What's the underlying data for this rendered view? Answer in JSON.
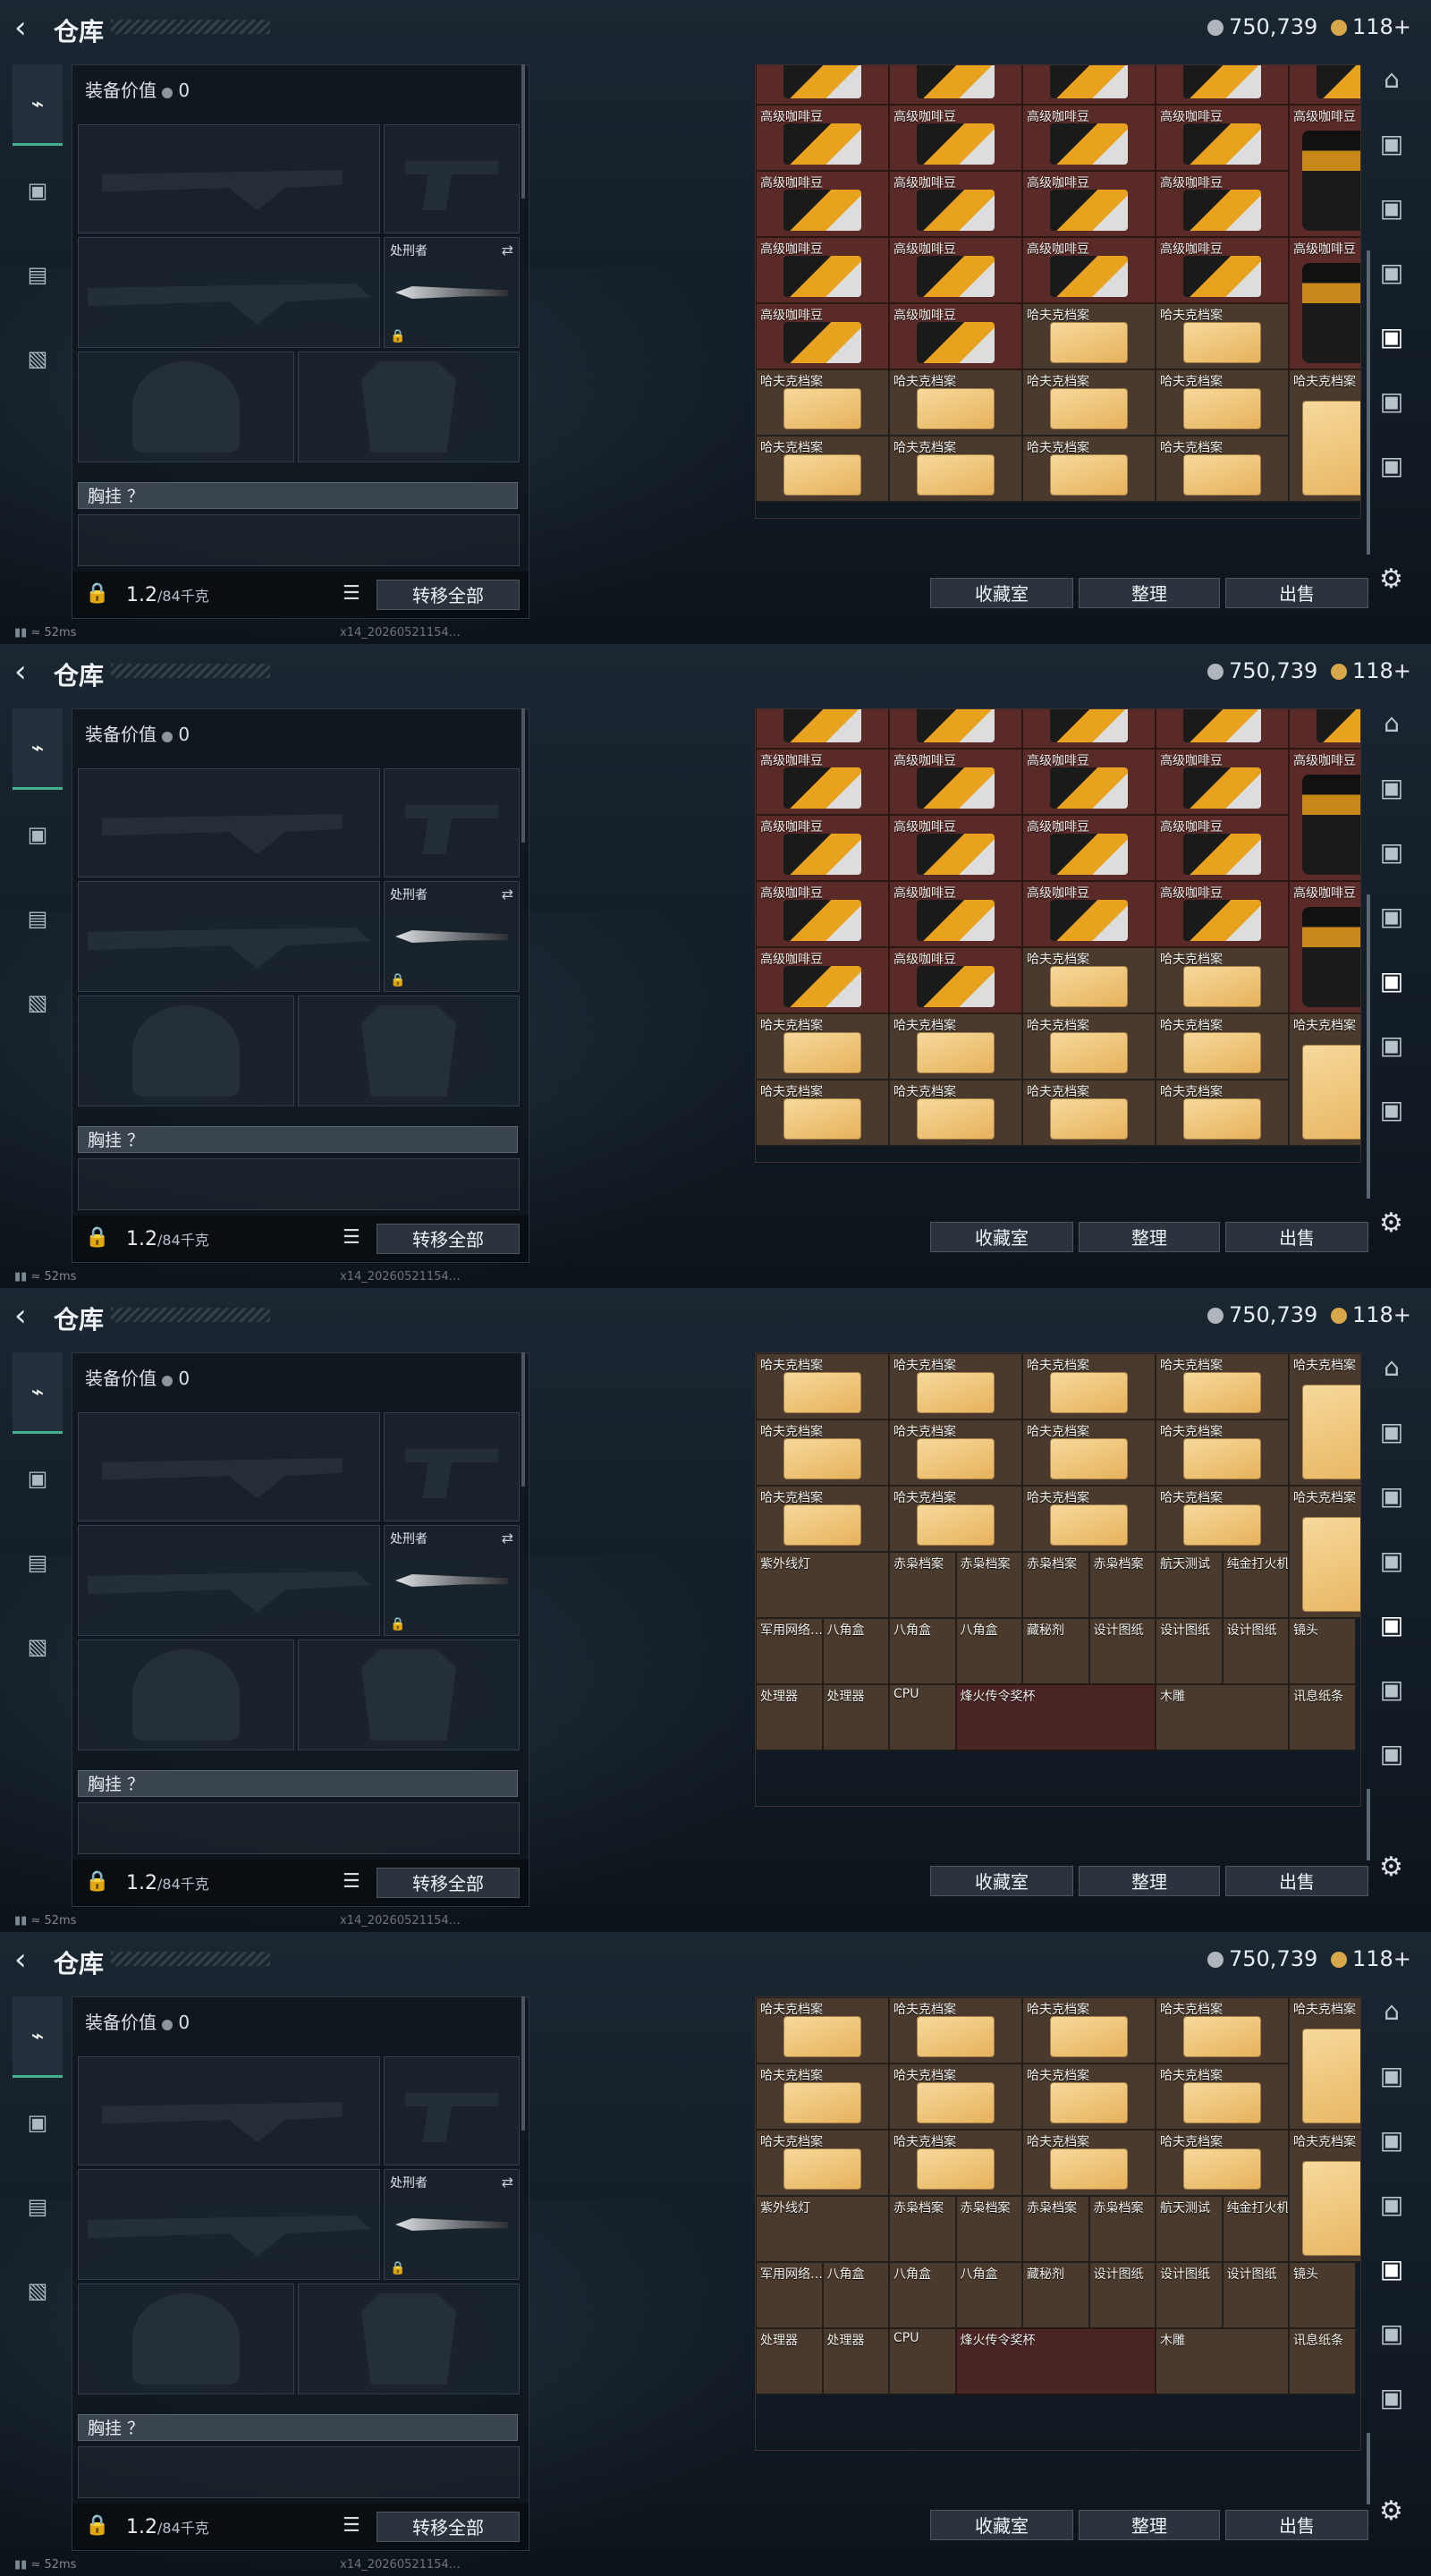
{
  "header": {
    "back_icon": "back-chevron-icon",
    "title": "仓库",
    "currency1": "750,739",
    "currency2": "118+",
    "currency1_color": "#b0b6bb",
    "currency2_color": "#d7a84a"
  },
  "tabs": [
    {
      "icon": "pistol-icon"
    },
    {
      "icon": "armor-icon"
    },
    {
      "icon": "clipboard-icon"
    },
    {
      "icon": "briefcase-icon"
    }
  ],
  "loadout": {
    "equip_value_label": "装备价值",
    "equip_value": "0",
    "melee_label": "处刑者",
    "chest_label": "胸挂 ？",
    "weight": "1.2",
    "weight_max": "/84千克",
    "transfer_all": "转移全部"
  },
  "buttons": {
    "collection": "收藏室",
    "sort": "整理",
    "sell": "出售"
  },
  "status": {
    "ping": "52ms",
    "version": "x14_20260521154…"
  },
  "items": {
    "coffee": "高级咖啡豆",
    "archive": "哈夫克档案",
    "ore_lamp": "紫外线灯",
    "red_archive": "赤枭档案",
    "aerospace_tool": "航天测试",
    "gold_lighter": "纯金打火机",
    "military_net": "军用网络…",
    "octagon": "八角盒",
    "hidden_cartridge": "藏秘剂",
    "design": "设计图纸",
    "lens": "镜头",
    "processor": "处理器",
    "cpu": "CPU",
    "trophy": "烽火传令奖杯",
    "wood_carving": "木雕",
    "intel": "讯息纸条"
  }
}
